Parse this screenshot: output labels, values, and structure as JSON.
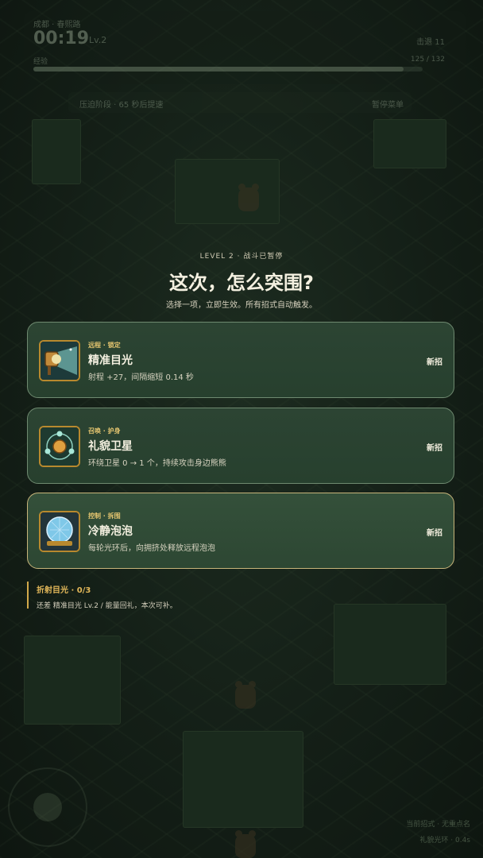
{
  "hud": {
    "location": "成都 · 春熙路",
    "time": "00:19",
    "level": "Lv.2",
    "kills": "击退 11",
    "xp_label": "经验",
    "xp_value": "125 / 132",
    "xp_progress": 0.95,
    "status_text": "压迫阶段 · 65 秒后提速",
    "status_button": "暂停菜单"
  },
  "panel": {
    "eyebrow": "LEVEL 2 · 战斗已暂停",
    "title": "这次，怎么突围?",
    "subtitle": "选择一项，立即生效。所有招式自动触发。"
  },
  "cards": [
    {
      "tag": "远程 · 锁定",
      "title": "精准目光",
      "desc": "射程 +27，间隔缩短 0.14 秒",
      "badge": "新招",
      "icon": "spotlight-icon"
    },
    {
      "tag": "召唤 · 护身",
      "title": "礼貌卫星",
      "desc": "环绕卫星 0 → 1 个，持续攻击身边熊熊",
      "badge": "新招",
      "icon": "orbit-satellite-icon"
    },
    {
      "tag": "控制 · 拆围",
      "title": "冷静泡泡",
      "desc": "每轮光环后，向拥挤处释放远程泡泡",
      "badge": "新招",
      "icon": "bubble-dome-icon"
    }
  ],
  "hint": {
    "title": "折射目光 · 0/3",
    "text": "还差 精准目光 Lv.2 / 能量回礼，本次可补。"
  },
  "corner": {
    "line1": "当前招式 · 无重点名",
    "line2": "礼貌光环 · 0.4s"
  },
  "colors": {
    "accent": "#e3c46f",
    "card_bg": "#2c4433",
    "selected_border": "#c7b57a"
  }
}
